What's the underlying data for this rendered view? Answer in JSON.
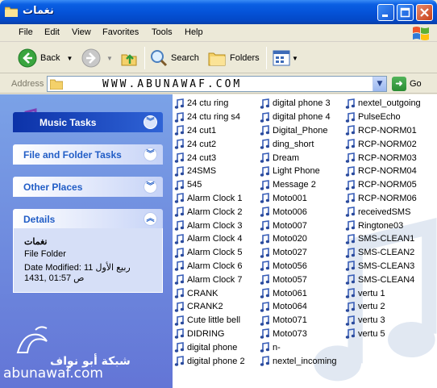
{
  "window": {
    "title": "نغمات"
  },
  "menu": [
    "File",
    "Edit",
    "View",
    "Favorites",
    "Tools",
    "Help"
  ],
  "toolbar": {
    "back": "Back",
    "search": "Search",
    "folders": "Folders"
  },
  "address": {
    "label": "Address",
    "value": "WWW.ABUNAWAF.COM",
    "go": "Go"
  },
  "tasks": {
    "music": "Music Tasks",
    "file_folder": "File and Folder Tasks",
    "other": "Other Places",
    "details": "Details"
  },
  "details": {
    "name": "نغمات",
    "type": "File Folder",
    "modified_line1": "Date Modified: 11 ربيع الأول",
    "modified_line2": "1431, 01:57 ص"
  },
  "watermark": {
    "arabic": "شبكة أبو نواف",
    "site": "abunawaf.com"
  },
  "files": {
    "col1": [
      "24 ctu ring",
      "24 ctu ring s4",
      "24 cut1",
      "24 cut2",
      "24 cut3",
      "24SMS",
      "545",
      "Alarm Clock 1",
      "Alarm Clock 2",
      "Alarm Clock 3",
      "Alarm Clock 4",
      "Alarm Clock 5",
      "Alarm Clock 6",
      "Alarm Clock 7",
      "CRANK",
      "CRANK2",
      "Cute little bell",
      "DIDRING",
      "digital phone",
      "digital phone 2"
    ],
    "col2": [
      "digital phone 3",
      "digital phone 4",
      "Digital_Phone",
      "ding_short",
      "Dream",
      "Light Phone",
      "Message 2",
      "Moto001",
      "Moto006",
      "Moto007",
      "Moto020",
      "Moto027",
      "Moto056",
      "Moto057",
      "Moto061",
      "Moto064",
      "Moto071",
      "Moto073",
      "n-",
      "nextel_incoming"
    ],
    "col3": [
      "nextel_outgoing",
      "PulseEcho",
      "RCP-NORM01",
      "RCP-NORM02",
      "RCP-NORM03",
      "RCP-NORM04",
      "RCP-NORM05",
      "RCP-NORM06",
      "receivedSMS",
      "Ringtone03",
      "SMS-CLEAN1",
      "SMS-CLEAN2",
      "SMS-CLEAN3",
      "SMS-CLEAN4",
      "vertu 1",
      "vertu 2",
      "vertu 3",
      "vertu 5"
    ]
  },
  "colors": {
    "title_blue": "#0553d8",
    "task_pane": "#6375d6",
    "link_blue": "#215dc6"
  }
}
